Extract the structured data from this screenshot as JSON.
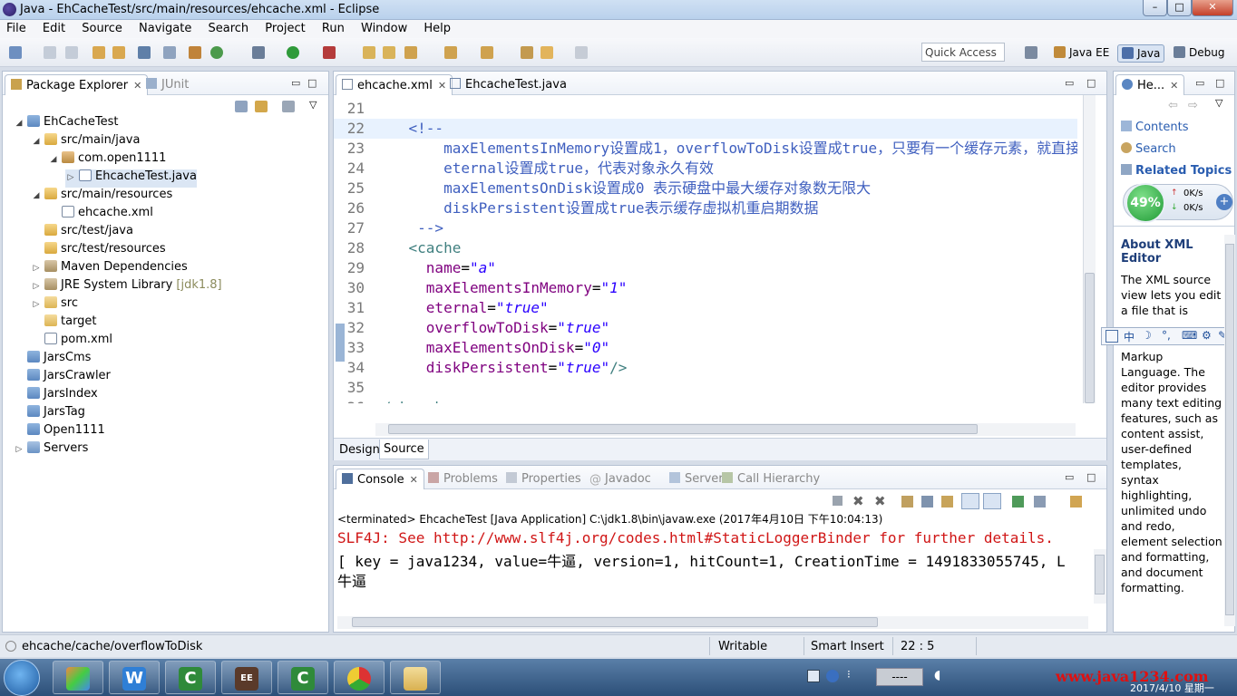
{
  "window": {
    "title": "Java - EhCacheTest/src/main/resources/ehcache.xml - Eclipse",
    "min_label": "–",
    "max_label": "□",
    "close_label": "✕"
  },
  "menu": [
    "File",
    "Edit",
    "Source",
    "Navigate",
    "Search",
    "Project",
    "Run",
    "Window",
    "Help"
  ],
  "toolbar": {
    "quick_access": "Quick Access",
    "perspectives": [
      {
        "label": "Java EE",
        "active": false
      },
      {
        "label": "Java",
        "active": true
      },
      {
        "label": "Debug",
        "active": false
      }
    ]
  },
  "package_explorer": {
    "tabs": [
      {
        "label": "Package Explorer",
        "active": true
      },
      {
        "label": "JUnit",
        "active": false
      }
    ],
    "tree": [
      {
        "label": "EhCacheTest",
        "indent": 0,
        "twisty": "◢",
        "icon": "proj"
      },
      {
        "label": "src/main/java",
        "indent": 1,
        "twisty": "◢",
        "icon": "pkgfolder"
      },
      {
        "label": "com.open1111",
        "indent": 2,
        "twisty": "◢",
        "icon": "pkg"
      },
      {
        "label": "EhcacheTest.java",
        "indent": 3,
        "twisty": "▷",
        "icon": "java",
        "selected": true
      },
      {
        "label": "src/main/resources",
        "indent": 1,
        "twisty": "◢",
        "icon": "pkgfolder"
      },
      {
        "label": "ehcache.xml",
        "indent": 2,
        "twisty": "",
        "icon": "xml"
      },
      {
        "label": "src/test/java",
        "indent": 1,
        "twisty": "",
        "icon": "pkgfolder"
      },
      {
        "label": "src/test/resources",
        "indent": 1,
        "twisty": "",
        "icon": "pkgfolder"
      },
      {
        "label": "Maven Dependencies",
        "indent": 1,
        "twisty": "▷",
        "icon": "lib"
      },
      {
        "label": "JRE System Library",
        "decor": "[jdk1.8]",
        "indent": 1,
        "twisty": "▷",
        "icon": "lib"
      },
      {
        "label": "src",
        "indent": 1,
        "twisty": "▷",
        "icon": "folder"
      },
      {
        "label": "target",
        "indent": 1,
        "twisty": "",
        "icon": "folder"
      },
      {
        "label": "pom.xml",
        "indent": 1,
        "twisty": "",
        "icon": "xml"
      },
      {
        "label": "JarsCms",
        "indent": 0,
        "twisty": "",
        "icon": "proj"
      },
      {
        "label": "JarsCrawler",
        "indent": 0,
        "twisty": "",
        "icon": "proj"
      },
      {
        "label": "JarsIndex",
        "indent": 0,
        "twisty": "",
        "icon": "proj"
      },
      {
        "label": "JarsTag",
        "indent": 0,
        "twisty": "",
        "icon": "proj"
      },
      {
        "label": "Open1111",
        "indent": 0,
        "twisty": "",
        "icon": "proj"
      },
      {
        "label": "Servers",
        "indent": 0,
        "twisty": "▷",
        "icon": "srv"
      }
    ]
  },
  "editor": {
    "tabs": [
      {
        "label": "ehcache.xml",
        "active": true
      },
      {
        "label": "EhcacheTest.java",
        "active": false
      }
    ],
    "lines": [
      {
        "n": "21",
        "parts": []
      },
      {
        "n": "22",
        "fold": true,
        "parts": [
          {
            "t": "    ",
            "c": ""
          },
          {
            "t": "<!--",
            "c": "cmt"
          }
        ]
      },
      {
        "n": "23",
        "parts": [
          {
            "t": "        maxElementsInMemory设置成1，overflowToDisk设置成true，只要有一个缓存元素，就直接",
            "c": "cmt"
          }
        ]
      },
      {
        "n": "24",
        "parts": [
          {
            "t": "        eternal设置成true，代表对象永久有效",
            "c": "cmt"
          }
        ]
      },
      {
        "n": "25",
        "parts": [
          {
            "t": "        maxElementsOnDisk设置成0 表示硬盘中最大缓存对象数无限大",
            "c": "cmt"
          }
        ]
      },
      {
        "n": "26",
        "parts": [
          {
            "t": "        diskPersistent设置成true表示缓存虚拟机重启期数据",
            "c": "cmt"
          }
        ]
      },
      {
        "n": "27",
        "parts": [
          {
            "t": "     -->",
            "c": "cmt"
          }
        ]
      },
      {
        "n": "28",
        "parts": [
          {
            "t": "    ",
            "c": ""
          },
          {
            "t": "<cache",
            "c": "tagc"
          }
        ]
      },
      {
        "n": "29",
        "parts": [
          {
            "t": "      ",
            "c": ""
          },
          {
            "t": "name",
            "c": "attrn"
          },
          {
            "t": "=",
            "c": ""
          },
          {
            "t": "\"a\"",
            "c": "attrv"
          }
        ]
      },
      {
        "n": "30",
        "parts": [
          {
            "t": "      ",
            "c": ""
          },
          {
            "t": "maxElementsInMemory",
            "c": "attrn"
          },
          {
            "t": "=",
            "c": ""
          },
          {
            "t": "\"1\"",
            "c": "attrv"
          }
        ]
      },
      {
        "n": "31",
        "parts": [
          {
            "t": "      ",
            "c": ""
          },
          {
            "t": "eternal",
            "c": "attrn"
          },
          {
            "t": "=",
            "c": ""
          },
          {
            "t": "\"true\"",
            "c": "attrv"
          }
        ]
      },
      {
        "n": "32",
        "parts": [
          {
            "t": "      ",
            "c": ""
          },
          {
            "t": "overflowToDisk",
            "c": "attrn"
          },
          {
            "t": "=",
            "c": ""
          },
          {
            "t": "\"true\"",
            "c": "attrv"
          }
        ]
      },
      {
        "n": "33",
        "parts": [
          {
            "t": "      ",
            "c": ""
          },
          {
            "t": "maxElementsOnDisk",
            "c": "attrn"
          },
          {
            "t": "=",
            "c": ""
          },
          {
            "t": "\"0\"",
            "c": "attrv"
          }
        ]
      },
      {
        "n": "34",
        "parts": [
          {
            "t": "      ",
            "c": ""
          },
          {
            "t": "diskPersistent",
            "c": "attrn"
          },
          {
            "t": "=",
            "c": ""
          },
          {
            "t": "\"true\"",
            "c": "attrv"
          },
          {
            "t": "/>",
            "c": "tagc"
          }
        ]
      },
      {
        "n": "35",
        "parts": []
      },
      {
        "n": "36",
        "parts": [
          {
            "t": "</ehcache>",
            "c": "tagc"
          }
        ]
      }
    ],
    "bottom_tabs": [
      {
        "label": "Design",
        "active": false
      },
      {
        "label": "Source",
        "active": true
      }
    ]
  },
  "console": {
    "tabs": [
      {
        "label": "Console",
        "active": true
      },
      {
        "label": "Problems",
        "active": false
      },
      {
        "label": "Properties",
        "active": false
      },
      {
        "label": "Javadoc",
        "active": false
      },
      {
        "label": "Servers",
        "active": false
      },
      {
        "label": "Call Hierarchy",
        "active": false
      }
    ],
    "status_line": "<terminated> EhcacheTest [Java Application] C:\\jdk1.8\\bin\\javaw.exe (2017年4月10日 下午10:04:13)",
    "lines": [
      {
        "text": "SLF4J: See http://www.slf4j.org/codes.html#StaticLoggerBinder for further details.",
        "color": "#d01616"
      },
      {
        "text": "[ key = java1234, value=牛逼, version=1, hitCount=1, CreationTime = 1491833055745, L",
        "color": "#000000"
      },
      {
        "text": "牛逼",
        "color": "#000000"
      }
    ]
  },
  "help": {
    "tab_label": "He...",
    "links": [
      "Contents",
      "Search",
      "Related Topics"
    ],
    "about_title": "About XML Editor",
    "body": "The XML source view lets you edit a file that is coded in the",
    "body2": "Markup Language. The editor provides many text editing features, such as content assist, user-defined templates, syntax highlighting, unlimited undo and redo, element selection and formatting, and document formatting.",
    "ime": "中"
  },
  "speed_widget": {
    "percent": "49%",
    "up": "0K/s",
    "down": "0K/s"
  },
  "statusbar": {
    "path": "ehcache/cache/overflowToDisk",
    "writable": "Writable",
    "insert_mode": "Smart Insert",
    "position": "22 : 5"
  },
  "taskbar": {
    "watermark": "www.java1234.com",
    "date": "2017/4/10 星期一",
    "ime_box": "----"
  },
  "colors": {
    "accent": "#3c6db0",
    "console_error": "#d01616"
  }
}
